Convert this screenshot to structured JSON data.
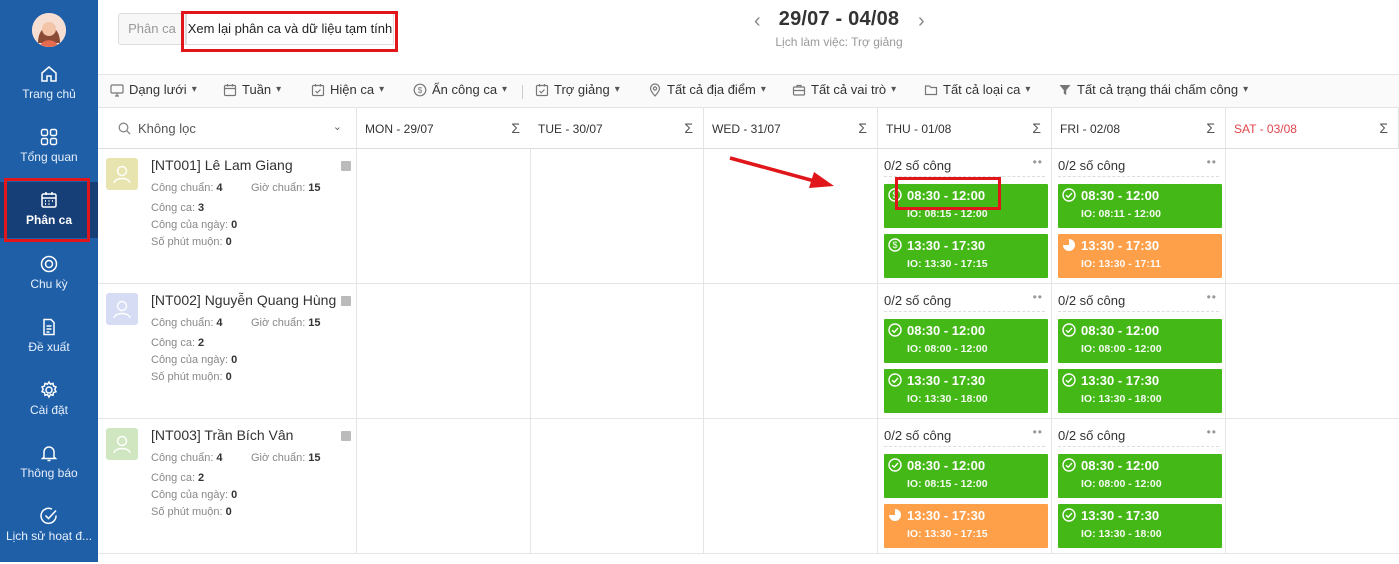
{
  "sidebar": {
    "items": [
      {
        "label": "Trang chủ",
        "icon": "home-icon"
      },
      {
        "label": "Tổng quan",
        "icon": "grid-icon"
      },
      {
        "label": "Phân ca",
        "icon": "calendar-icon"
      },
      {
        "label": "Chu kỳ",
        "icon": "cycle-icon"
      },
      {
        "label": "Đề xuất",
        "icon": "document-icon"
      },
      {
        "label": "Cài đặt",
        "icon": "gear-icon"
      },
      {
        "label": "Thông báo",
        "icon": "bell-icon"
      },
      {
        "label": "Lịch sử hoạt đ...",
        "icon": "check-circle-icon"
      }
    ]
  },
  "header": {
    "tab_shift": "Phân ca",
    "tab_review": "Xem lại phân ca và dữ liệu tạm tính",
    "date_range": "29/07 - 04/08",
    "schedule_label": "Lịch làm việc: Trợ giảng"
  },
  "toolbar": {
    "view": "Dạng lưới",
    "period": "Tuần",
    "show_shift": "Hiện ca",
    "hide_work": "Ẩn công ca",
    "role": "Trợ giảng",
    "locations": "Tất cả địa điểm",
    "roles": "Tất cả vai trò",
    "shift_types": "Tất cả loại ca",
    "attendance_status": "Tất cả trạng thái chấm công"
  },
  "grid": {
    "filter_label": "Không lọc",
    "sigma": "Σ",
    "days": [
      "MON - 29/07",
      "TUE - 30/07",
      "WED - 31/07",
      "THU - 01/08",
      "FRI - 02/08",
      "SAT - 03/08"
    ],
    "colors": {
      "weekend": "#e0454b",
      "green": "#44b816",
      "orange": "#fe9f4a",
      "highlight": "#e0161b"
    }
  },
  "labels": {
    "standard_work": "Công chuẩn:",
    "standard_hours": "Giờ chuẩn:",
    "shift_work": "Công ca:",
    "daily_work": "Công của ngày:",
    "late_minutes": "Số phút muộn:",
    "work_count": "0/2 số công"
  },
  "employees": [
    {
      "name": "[NT001] Lê Lam Giang",
      "avatar_color": "#e8e4b0",
      "standard_work": "4",
      "standard_hours": "15",
      "shift_work": "3",
      "daily_work": "0",
      "late_minutes": "0",
      "thu": [
        {
          "time": "08:30 - 12:00",
          "io": "IO: 08:15 - 12:00",
          "color": "green",
          "icon": "dollar-circle-icon"
        },
        {
          "time": "13:30 - 17:30",
          "io": "IO: 13:30 - 17:15",
          "color": "green",
          "icon": "dollar-circle-icon"
        }
      ],
      "fri": [
        {
          "time": "08:30 - 12:00",
          "io": "IO: 08:11 - 12:00",
          "color": "green",
          "icon": "check-circle-icon"
        },
        {
          "time": "13:30 - 17:30",
          "io": "IO: 13:30 - 17:11",
          "color": "orange",
          "icon": "clock-icon"
        }
      ]
    },
    {
      "name": "[NT002] Nguyễn Quang Hùng",
      "avatar_color": "#d5dcf3",
      "standard_work": "4",
      "standard_hours": "15",
      "shift_work": "2",
      "daily_work": "0",
      "late_minutes": "0",
      "thu": [
        {
          "time": "08:30 - 12:00",
          "io": "IO: 08:00 - 12:00",
          "color": "green",
          "icon": "check-circle-icon"
        },
        {
          "time": "13:30 - 17:30",
          "io": "IO: 13:30 - 18:00",
          "color": "green",
          "icon": "check-circle-icon"
        }
      ],
      "fri": [
        {
          "time": "08:30 - 12:00",
          "io": "IO: 08:00 - 12:00",
          "color": "green",
          "icon": "check-circle-icon"
        },
        {
          "time": "13:30 - 17:30",
          "io": "IO: 13:30 - 18:00",
          "color": "green",
          "icon": "check-circle-icon"
        }
      ]
    },
    {
      "name": "[NT003] Trần Bích Vân",
      "avatar_color": "#cfe6c0",
      "standard_work": "4",
      "standard_hours": "15",
      "shift_work": "2",
      "daily_work": "0",
      "late_minutes": "0",
      "thu": [
        {
          "time": "08:30 - 12:00",
          "io": "IO: 08:15 - 12:00",
          "color": "green",
          "icon": "check-circle-icon"
        },
        {
          "time": "13:30 - 17:30",
          "io": "IO: 13:30 - 17:15",
          "color": "orange",
          "icon": "clock-icon"
        }
      ],
      "fri": [
        {
          "time": "08:30 - 12:00",
          "io": "IO: 08:00 - 12:00",
          "color": "green",
          "icon": "check-circle-icon"
        },
        {
          "time": "13:30 - 17:30",
          "io": "IO: 13:30 - 18:00",
          "color": "green",
          "icon": "check-circle-icon"
        }
      ]
    }
  ]
}
